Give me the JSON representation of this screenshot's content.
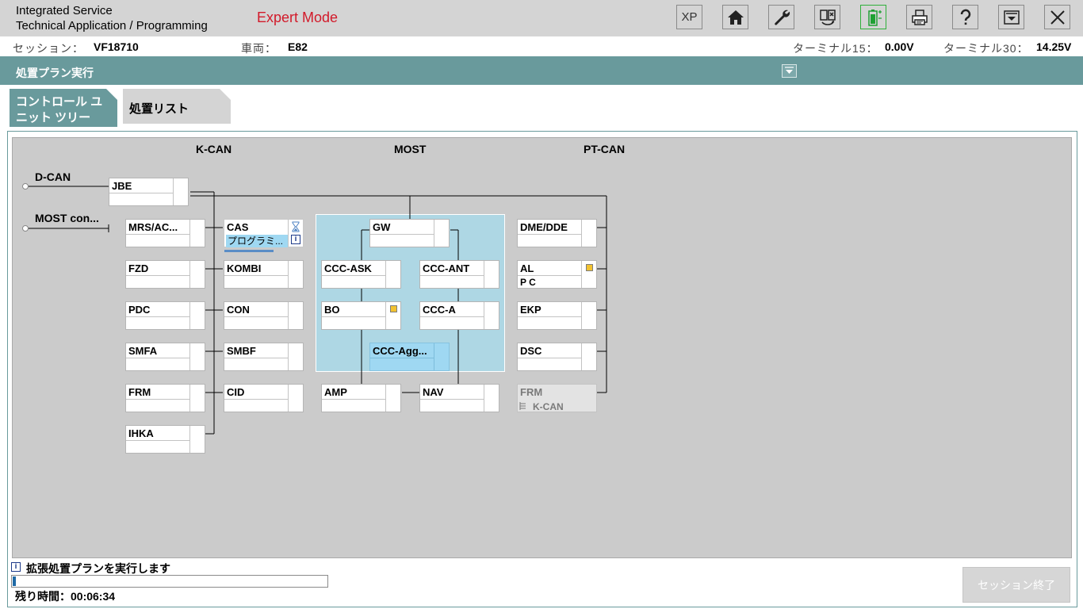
{
  "header": {
    "title_line1": "Integrated Service",
    "title_line2": "Technical Application / Programming",
    "mode": "Expert Mode",
    "buttons": {
      "xp": "XP"
    }
  },
  "session": {
    "session_label": "セッション：",
    "session_value": "VF18710",
    "vehicle_label": "車両：",
    "vehicle_value": "E82",
    "t15_label": "ターミナル15：",
    "t15_value": "0.00V",
    "t30_label": "ターミナル30：",
    "t30_value": "14.25V"
  },
  "title_bar": "処置プラン実行",
  "tabs": {
    "ecu_tree": "コントロール ユニット ツリー",
    "ecu_list": "処置リスト"
  },
  "diagram": {
    "buses": {
      "k_can": "K-CAN",
      "most": "MOST",
      "pt_can": "PT-CAN",
      "d_can": "D-CAN",
      "most_con": "MOST con..."
    },
    "ecus": {
      "jbe": "JBE",
      "mrs": "MRS/AC...",
      "fzd": "FZD",
      "pdc": "PDC",
      "smfa": "SMFA",
      "frm_k": "FRM",
      "ihka": "IHKA",
      "cas": "CAS",
      "cas_status": "プログラミ...",
      "kombi": "KOMBI",
      "con": "CON",
      "smbf": "SMBF",
      "cid": "CID",
      "gw": "GW",
      "ccc_ask": "CCC-ASK",
      "ccc_ant": "CCC-ANT",
      "bo": "BO",
      "ccc_a": "CCC-A",
      "ccc_agg": "CCC-Agg...",
      "amp": "AMP",
      "nav": "NAV",
      "dme": "DME/DDE",
      "al": "AL",
      "al_sub": "P C",
      "ekp": "EKP",
      "dsc": "DSC",
      "frm_pt": "FRM",
      "frm_pt_sub": "K-CAN"
    }
  },
  "footer": {
    "status_message": "拡張処置プランを実行します",
    "progress": 0.01,
    "remaining": "残り時間：00:06:34",
    "end_session": "セッション終了"
  },
  "colors": {
    "accent": "#699a9c",
    "mode": "#d21a2a",
    "selected": "#9fd8f2",
    "most_region": "#aed7e4",
    "warning": "#f2c230"
  }
}
